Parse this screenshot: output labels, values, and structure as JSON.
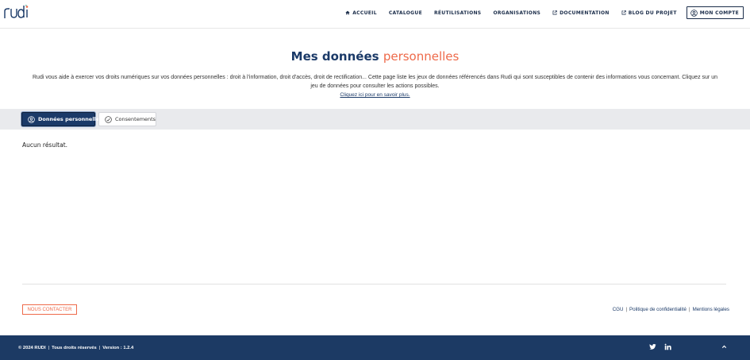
{
  "header": {
    "logo_text": "rudi",
    "nav": [
      {
        "label": "ACCUEIL",
        "icon": "home-icon"
      },
      {
        "label": "CATALOGUE",
        "icon": ""
      },
      {
        "label": "RÉUTILISATIONS",
        "icon": ""
      },
      {
        "label": "ORGANISATIONS",
        "icon": ""
      },
      {
        "label": "DOCUMENTATION",
        "icon": "external-link-icon"
      },
      {
        "label": "BLOG DU PROJET",
        "icon": "external-link-icon"
      }
    ],
    "account_label": "MON COMPTE"
  },
  "hero": {
    "title_main": "Mes données",
    "title_accent": "personnelles",
    "description": "Rudi vous aide à exercer vos droits numériques sur vos données personnelles : droit à l'information, droit d'accès, droit de rectification... Cette page liste les jeux de données référencés dans Rudi qui sont susceptibles de contenir des informations vous concernant. Cliquez sur un jeu de données pour consulter les actions possibles.",
    "link_label": "Cliquez ici pour en savoir plus."
  },
  "tabs": [
    {
      "label": "Données personnelles",
      "active": true
    },
    {
      "label": "Consentements",
      "active": false
    }
  ],
  "main": {
    "empty_message": "Aucun résultat."
  },
  "contact_button": "NOUS CONTACTER",
  "legal_links": [
    "CGU",
    "Politique de confidentialité",
    "Mentions légales"
  ],
  "footer": {
    "copyright": "© 2024 RUDI",
    "rights": "Tous droits réservés",
    "version_label": "Version",
    "version_sep": ":",
    "version_value": "1.2.4"
  },
  "colors": {
    "brand_navy": "#1b3a68",
    "accent_orange": "#ee6a4a",
    "footer_bg": "#1c3a64",
    "tabs_bg": "#e9eaed"
  }
}
